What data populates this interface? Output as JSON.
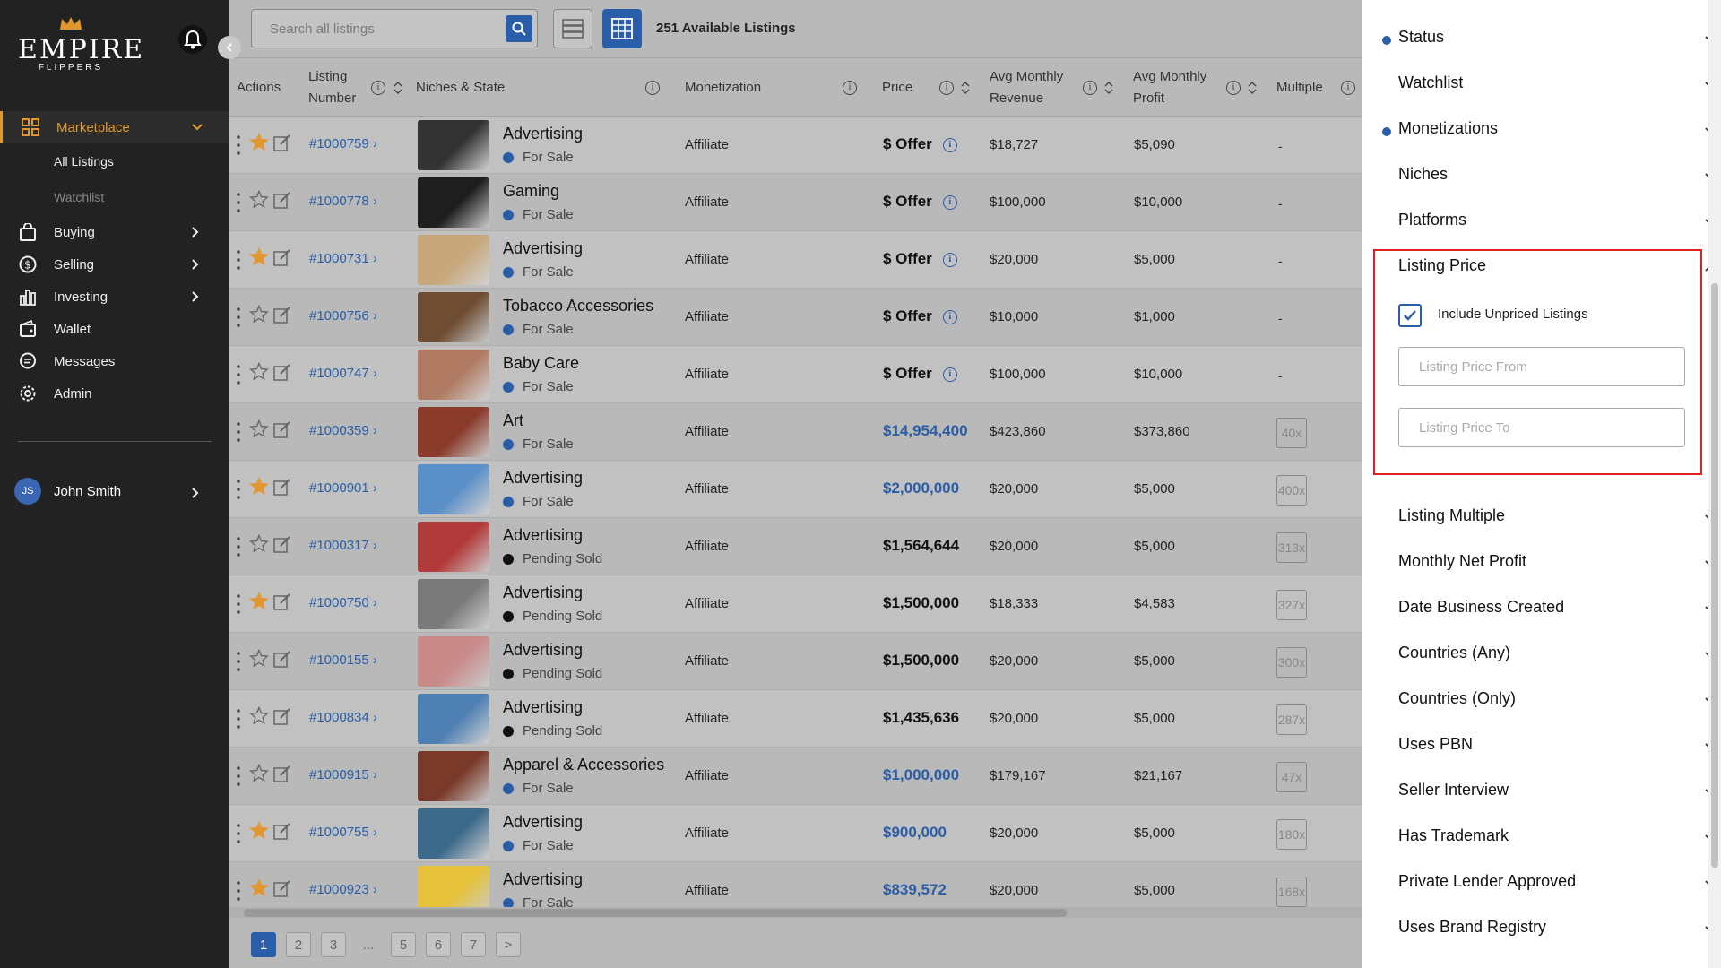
{
  "brand": {
    "name": "EMPIRE",
    "sub": "FLIPPERS"
  },
  "sidebar": {
    "marketplace": "Marketplace",
    "all_listings": "All Listings",
    "watchlist": "Watchlist",
    "buying": "Buying",
    "selling": "Selling",
    "investing": "Investing",
    "wallet": "Wallet",
    "messages": "Messages",
    "admin": "Admin",
    "user_initials": "JS",
    "user_name": "John Smith"
  },
  "toolbar": {
    "search_placeholder": "Search all listings",
    "count": "251 Available Listings"
  },
  "columns": {
    "actions": "Actions",
    "listing_number_1": "Listing",
    "listing_number_2": "Number",
    "niches": "Niches & State",
    "monetization": "Monetization",
    "price": "Price",
    "rev_1": "Avg Monthly",
    "rev_2": "Revenue",
    "prof_1": "Avg Monthly",
    "prof_2": "Profit",
    "multiple": "Multiple"
  },
  "rows": [
    {
      "num": "#1000759",
      "niche": "Advertising",
      "state": "For Sale",
      "monet": "Affiliate",
      "price": "$ Offer",
      "rev": "$18,727",
      "prof": "$5,090",
      "mult": "-",
      "star": true
    },
    {
      "num": "#1000778",
      "niche": "Gaming",
      "state": "For Sale",
      "monet": "Affiliate",
      "price": "$ Offer",
      "rev": "$100,000",
      "prof": "$10,000",
      "mult": "-",
      "star": false
    },
    {
      "num": "#1000731",
      "niche": "Advertising",
      "state": "For Sale",
      "monet": "Affiliate",
      "price": "$ Offer",
      "rev": "$20,000",
      "prof": "$5,000",
      "mult": "-",
      "star": true
    },
    {
      "num": "#1000756",
      "niche": "Tobacco Accessories",
      "state": "For Sale",
      "monet": "Affiliate",
      "price": "$ Offer",
      "rev": "$10,000",
      "prof": "$1,000",
      "mult": "-",
      "star": false
    },
    {
      "num": "#1000747",
      "niche": "Baby Care",
      "state": "For Sale",
      "monet": "Affiliate",
      "price": "$ Offer",
      "rev": "$100,000",
      "prof": "$10,000",
      "mult": "-",
      "star": false
    },
    {
      "num": "#1000359",
      "niche": "Art",
      "state": "For Sale",
      "monet": "Affiliate",
      "price": "$14,954,400",
      "rev": "$423,860",
      "prof": "$373,860",
      "mult": "40x",
      "star": false
    },
    {
      "num": "#1000901",
      "niche": "Advertising",
      "state": "For Sale",
      "monet": "Affiliate",
      "price": "$2,000,000",
      "rev": "$20,000",
      "prof": "$5,000",
      "mult": "400x",
      "star": true
    },
    {
      "num": "#1000317",
      "niche": "Advertising",
      "state": "Pending Sold",
      "monet": "Affiliate",
      "price": "$1,564,644",
      "rev": "$20,000",
      "prof": "$5,000",
      "mult": "313x",
      "star": false
    },
    {
      "num": "#1000750",
      "niche": "Advertising",
      "state": "Pending Sold",
      "monet": "Affiliate",
      "price": "$1,500,000",
      "rev": "$18,333",
      "prof": "$4,583",
      "mult": "327x",
      "star": true
    },
    {
      "num": "#1000155",
      "niche": "Advertising",
      "state": "Pending Sold",
      "monet": "Affiliate",
      "price": "$1,500,000",
      "rev": "$20,000",
      "prof": "$5,000",
      "mult": "300x",
      "star": false
    },
    {
      "num": "#1000834",
      "niche": "Advertising",
      "state": "Pending Sold",
      "monet": "Affiliate",
      "price": "$1,435,636",
      "rev": "$20,000",
      "prof": "$5,000",
      "mult": "287x",
      "star": false
    },
    {
      "num": "#1000915",
      "niche": "Apparel & Accessories",
      "state": "For Sale",
      "monet": "Affiliate",
      "price": "$1,000,000",
      "rev": "$179,167",
      "prof": "$21,167",
      "mult": "47x",
      "star": false
    },
    {
      "num": "#1000755",
      "niche": "Advertising",
      "state": "For Sale",
      "monet": "Affiliate",
      "price": "$900,000",
      "rev": "$20,000",
      "prof": "$5,000",
      "mult": "180x",
      "star": true
    },
    {
      "num": "#1000923",
      "niche": "Advertising",
      "state": "For Sale",
      "monet": "Affiliate",
      "price": "$839,572",
      "rev": "$20,000",
      "prof": "$5,000",
      "mult": "168x",
      "star": true
    }
  ],
  "thumb_colors": [
    "#333333",
    "#1e1e1e",
    "#c8a87a",
    "#6e4d33",
    "#b07a62",
    "#8a3b2a",
    "#5b8fc7",
    "#b33a3a",
    "#7a7a7a",
    "#c98a8a",
    "#4d7fb3",
    "#7a3a2a",
    "#3c6a8a",
    "#e6c23a"
  ],
  "pagination": {
    "p1": "1",
    "p2": "2",
    "p3": "3",
    "ellipsis": "...",
    "p5": "5",
    "p6": "6",
    "p7": "7",
    "next": ">"
  },
  "filters": {
    "status": "Status",
    "watchlist": "Watchlist",
    "monetizations": "Monetizations",
    "niches": "Niches",
    "platforms": "Platforms",
    "listing_price": "Listing Price",
    "include_unpriced": "Include Unpriced Listings",
    "price_from_placeholder": "Listing Price From",
    "price_to_placeholder": "Listing Price To",
    "listing_multiple": "Listing Multiple",
    "monthly_net_profit": "Monthly Net Profit",
    "date_created": "Date Business Created",
    "countries_any": "Countries (Any)",
    "countries_only": "Countries (Only)",
    "uses_pbn": "Uses PBN",
    "seller_interview": "Seller Interview",
    "has_trademark": "Has Trademark",
    "private_lender": "Private Lender Approved",
    "brand_registry": "Uses Brand Registry"
  },
  "colors": {
    "accent": "#2a5ea8",
    "brand": "#e0982e",
    "highlight": "#e02020"
  }
}
